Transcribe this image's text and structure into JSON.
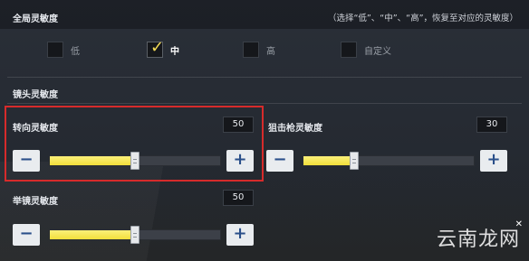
{
  "global": {
    "title": "全局灵敏度",
    "hint": "（选择“低”、“中”、“高”，恢复至对应的灵敏度）",
    "options": [
      {
        "label": "低",
        "checked": false
      },
      {
        "label": "中",
        "checked": true
      },
      {
        "label": "高",
        "checked": false
      },
      {
        "label": "自定义",
        "checked": false
      }
    ]
  },
  "camera": {
    "title": "镜头灵敏度",
    "sliders": [
      {
        "label": "转向灵敏度",
        "value": "50",
        "level": 0.5
      },
      {
        "label": "狙击枪灵敏度",
        "value": "30",
        "level": 0.3
      },
      {
        "label": "举镜灵敏度",
        "value": "50",
        "level": 0.5
      }
    ]
  },
  "buttons": {
    "minus": "−",
    "plus": "+"
  },
  "check_glyph": "✓",
  "accent_color": "#f2df3b",
  "highlight_color": "#d62b2b",
  "watermark": {
    "text": "云南龙网"
  }
}
